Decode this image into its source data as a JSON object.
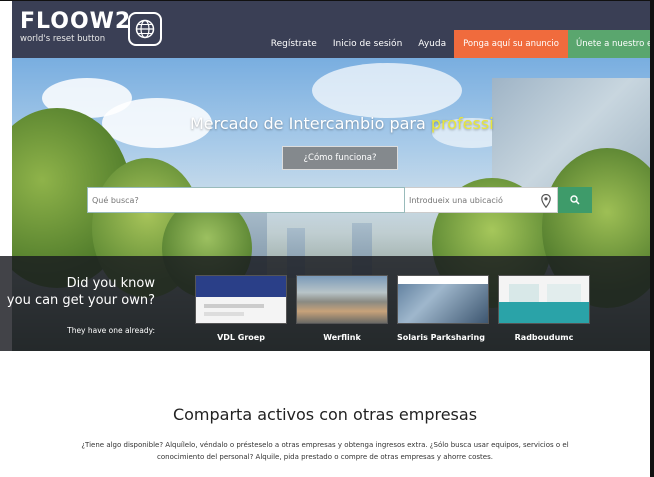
{
  "brand": {
    "logo_text": "FLOOW2",
    "tagline": "world's reset button"
  },
  "nav": {
    "items": [
      {
        "label": "Regístrate"
      },
      {
        "label": "Inicio de sesión"
      },
      {
        "label": "Ayuda"
      }
    ],
    "cta_post": "Ponga aquí su anuncio",
    "cta_join": "Únete a nuestro equipo"
  },
  "hero": {
    "title_main": "Mercado de Intercambio para ",
    "title_highlight": "professi",
    "how_button": "¿Cómo funciona?",
    "search_what_placeholder": "Qué busca?",
    "search_where_placeholder": "Introdueix una ubicació"
  },
  "showcase": {
    "question_line1": "Did you know",
    "question_line2": "you can get your own?",
    "subtitle": "They have one already:",
    "sites": [
      {
        "name": "VDL Groep"
      },
      {
        "name": "Werflink"
      },
      {
        "name": "Solaris Parksharing"
      },
      {
        "name": "Radboudumc"
      }
    ]
  },
  "section": {
    "title": "Comparta activos con otras empresas",
    "text": "¿Tiene algo disponible? Alquílelo, véndalo o présteselo a otras empresas y obtenga ingresos extra. ¿Sólo busca usar equipos, servicios o el conocimiento del personal? Alquile, pida prestado o compre de otras empresas y ahorre costes."
  },
  "colors": {
    "nav_bg": "#3a3f55",
    "cta_orange": "#f06b3d",
    "cta_green": "#5aa66e",
    "highlight": "#e8e63a",
    "search_button": "#3e9b6a"
  },
  "icons": {
    "logo": "globe-icon",
    "location": "location-pin-icon",
    "search": "search-icon"
  }
}
